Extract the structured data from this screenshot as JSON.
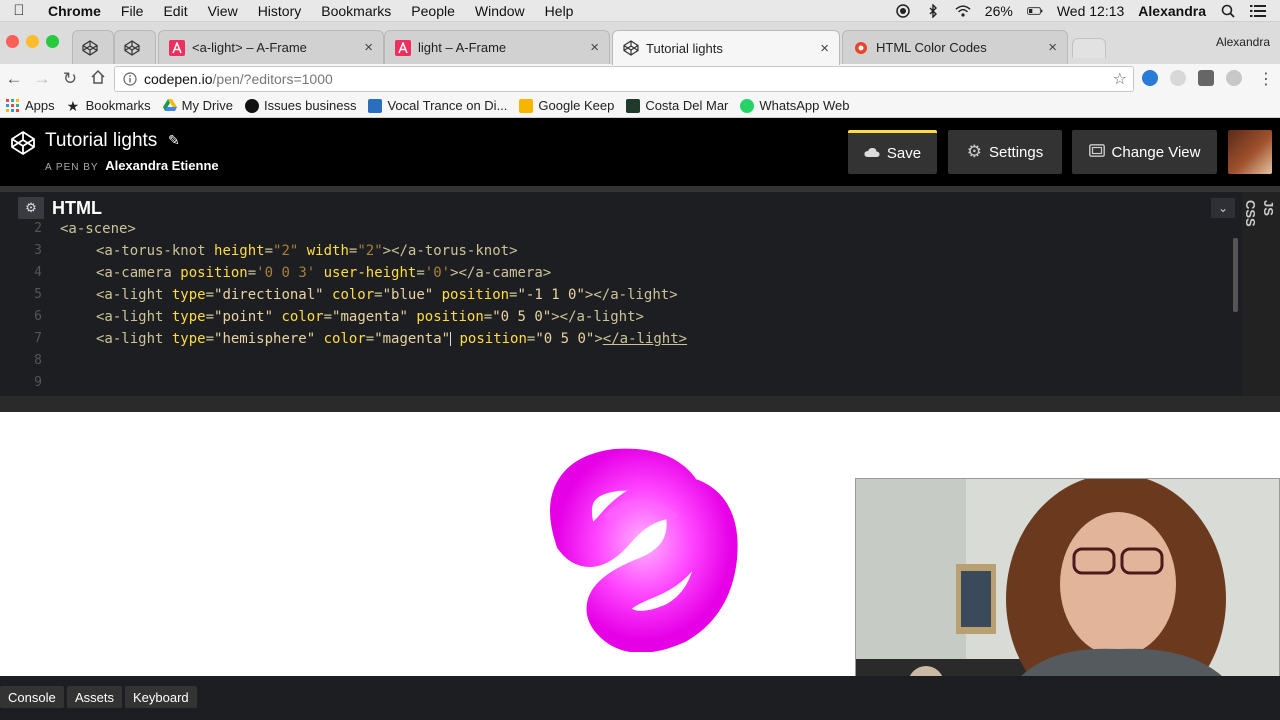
{
  "menubar": {
    "app_name": "Chrome",
    "items": [
      "File",
      "Edit",
      "View",
      "History",
      "Bookmarks",
      "People",
      "Window",
      "Help"
    ],
    "battery": "26%",
    "clock": "Wed 12:13",
    "user": "Alexandra"
  },
  "tabs": [
    {
      "label": "",
      "icon": "codepen-icon"
    },
    {
      "label": "",
      "icon": "codepen-icon"
    },
    {
      "label": "<a-light> – A-Frame",
      "icon": "aframe-icon"
    },
    {
      "label": "light – A-Frame",
      "icon": "aframe-icon"
    },
    {
      "label": "Tutorial lights",
      "icon": "codepen-icon"
    },
    {
      "label": "HTML Color Codes",
      "icon": "htmlcolorcodes-icon"
    }
  ],
  "profile_name": "Alexandra",
  "address": {
    "host": "codepen.io",
    "path": "/pen/?editors=1000"
  },
  "bookmarks": [
    {
      "label": "Apps",
      "icon": "apps-grid-icon"
    },
    {
      "label": "Bookmarks",
      "icon": "star-icon"
    },
    {
      "label": "My Drive",
      "icon": "drive-icon"
    },
    {
      "label": "Issues business",
      "icon": "github-icon"
    },
    {
      "label": "Vocal Trance on Di...",
      "icon": "di-icon"
    },
    {
      "label": "Google Keep",
      "icon": "keep-icon"
    },
    {
      "label": "Costa Del Mar",
      "icon": "costa-icon"
    },
    {
      "label": "WhatsApp Web",
      "icon": "whatsapp-icon"
    }
  ],
  "codepen": {
    "title": "Tutorial lights",
    "by_label": "A PEN BY",
    "author": "Alexandra Etienne",
    "save_label": "Save",
    "settings_label": "Settings",
    "change_view_label": "Change View"
  },
  "editor": {
    "title": "HTML",
    "side_tabs": [
      "CSS",
      "JS"
    ],
    "line_numbers": [
      "2",
      "3",
      "4",
      "5",
      "6",
      "7",
      "8",
      "9"
    ]
  },
  "bottom": {
    "console_label": "Console",
    "assets_label": "Assets",
    "keyboard_label": "Keyboard"
  },
  "colors": {
    "codepen_save_accent": "#ffdd40",
    "knot_color": "#ff33ff",
    "editor_bg": "#1d1e22"
  }
}
